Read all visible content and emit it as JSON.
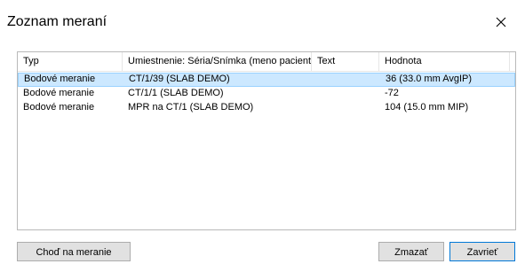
{
  "dialog": {
    "title": "Zoznam meraní",
    "close_icon": "close-icon"
  },
  "table": {
    "columns": [
      "Typ",
      "Umiestnenie: Séria/Snímka (meno pacienta)",
      "Text",
      "Hodnota"
    ],
    "rows": [
      {
        "typ": "Bodové meranie",
        "umiestnenie": "CT/1/39  (SLAB DEMO)",
        "text": "",
        "hodnota": "36  (33.0 mm AvgIP)",
        "selected": true
      },
      {
        "typ": "Bodové meranie",
        "umiestnenie": "CT/1/1  (SLAB DEMO)",
        "text": "",
        "hodnota": "-72",
        "selected": false
      },
      {
        "typ": "Bodové meranie",
        "umiestnenie": "MPR na CT/1  (SLAB DEMO)",
        "text": "",
        "hodnota": "104  (15.0 mm MIP)",
        "selected": false
      }
    ]
  },
  "buttons": {
    "goto": "Choď na meranie",
    "delete": "Zmazať",
    "close": "Zavrieť"
  },
  "colors": {
    "selection_bg": "#cce8ff",
    "selection_border": "#99d1ff",
    "default_button_border": "#0078d7"
  }
}
